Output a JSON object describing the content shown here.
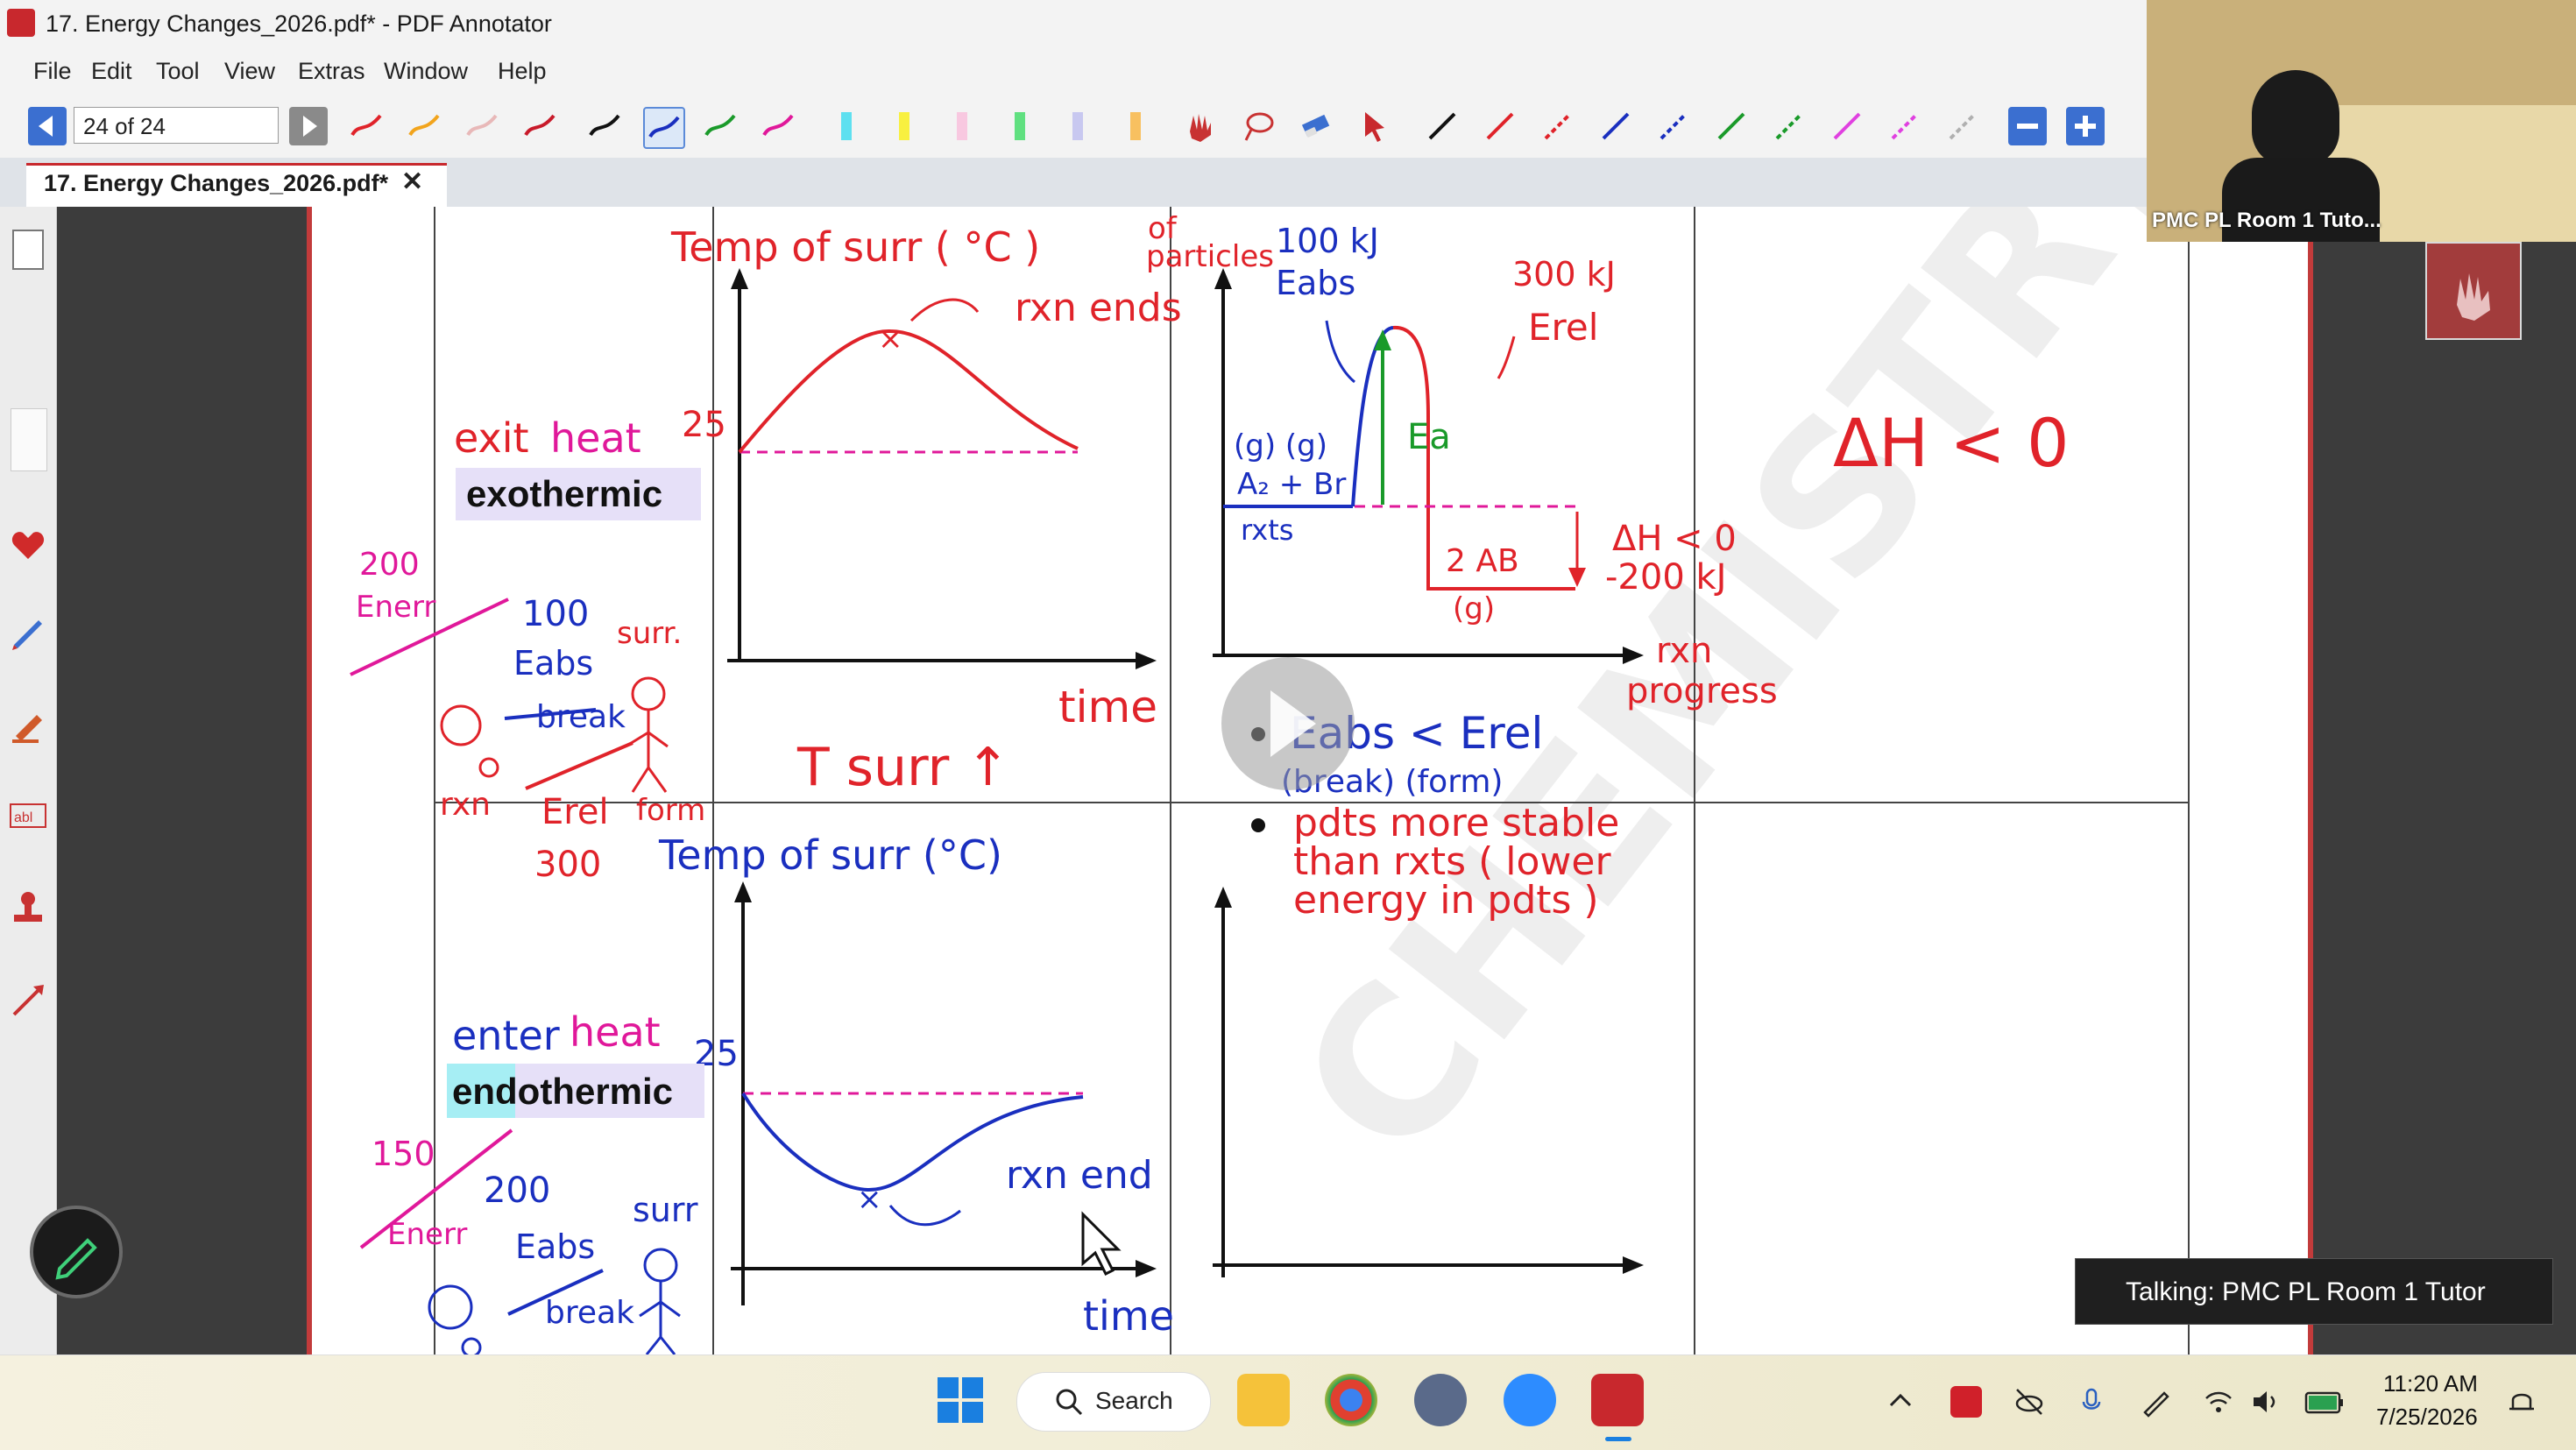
{
  "window": {
    "title": "17. Energy Changes_2026.pdf* - PDF Annotator"
  },
  "menu": [
    "File",
    "Edit",
    "Tool",
    "View",
    "Extras",
    "Window",
    "Help"
  ],
  "toolbar": {
    "page_value": "24 of 24"
  },
  "tab": {
    "label": "17. Energy Changes_2026.pdf*",
    "close": "✕"
  },
  "notes": {
    "exit_heat": [
      "exit",
      "heat"
    ],
    "exothermic": "exothermic",
    "endothermic": "endothermic",
    "enter_heat": [
      "enter",
      "heat"
    ],
    "temp_surr_top": "Temp of surr ( °C )",
    "temp_surr_bottom": "Temp of surr (°C)",
    "t25_top": "25",
    "t25_bottom": "25",
    "rxn_ends": "rxn ends",
    "rxn_end": "rxn end",
    "time_top": "time",
    "time_bottom": "time",
    "t_surr_up": "T surr ↑",
    "e200": "200",
    "enerr_top": "Enerr",
    "e100": "100",
    "eabs_left_top": "Eabs",
    "break_top": "break",
    "surr_top": "surr.",
    "rxn_left": "rxn",
    "erel_left": "Erel",
    "form_left": "form",
    "e300": "300",
    "e150": "150",
    "enerr_bottom": "Enerr",
    "e200b": "200",
    "eabs_left_bottom": "Eabs",
    "break_bottom": "break",
    "surr_bottom": "surr",
    "of_particles": [
      "of",
      "particles"
    ],
    "kj100": "100 kJ",
    "eabs_right": "Eabs",
    "kj300": "300 kJ",
    "erel_right": "Erel",
    "ea": "Ea",
    "gg": "(g)  (g)",
    "a2br": "A₂ + Br",
    "rxts": "rxts",
    "ab2": "2 AB",
    "g_single": "(g)",
    "dh_lt0_small": "ΔH < 0",
    "minus200": "-200 kJ",
    "rxn_progress": [
      "rxn",
      "progress"
    ],
    "dh_big": "ΔH < 0",
    "bullet1_a": "Eabs  <  Erel",
    "bullet1_b": "(break)     (form)",
    "bullet2": [
      "pdts more stable",
      "than rxts ( lower",
      "energy in pdts )"
    ],
    "watermark": "CHEMISTRY CAFE"
  },
  "video": {
    "label": "PMC PL Room 1 Tuto..."
  },
  "talking": "Talking: PMC PL Room 1 Tutor",
  "taskbar": {
    "search": "Search",
    "time": "11:20 AM",
    "date": "7/25/2026"
  },
  "colors": {
    "red_ink": "#e0232a",
    "blue_ink": "#1a2fbf",
    "magenta": "#e0189a",
    "green": "#1a9a2a",
    "accent": "#c8282d"
  }
}
